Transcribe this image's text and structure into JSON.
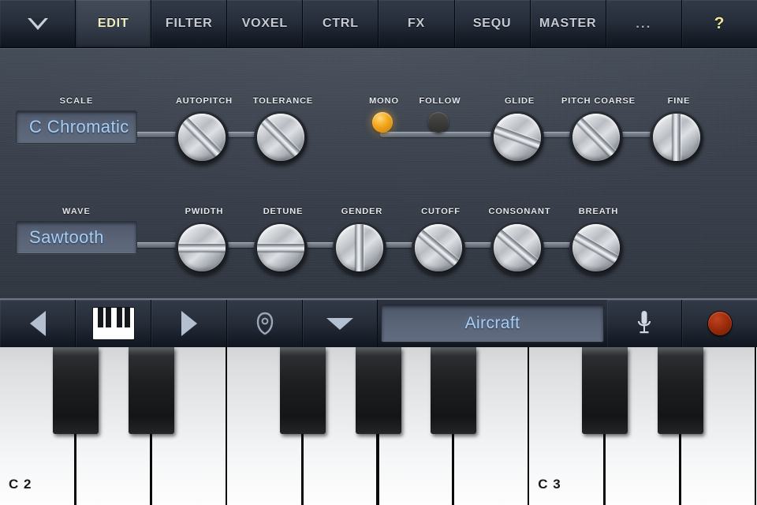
{
  "tabs": [
    {
      "id": "menu",
      "label": "",
      "icon": "triangle-down-icon",
      "active": false
    },
    {
      "id": "edit",
      "label": "EDIT",
      "icon": "",
      "active": true
    },
    {
      "id": "filter",
      "label": "FILTER",
      "icon": "",
      "active": false
    },
    {
      "id": "voxel",
      "label": "VOXEL",
      "icon": "",
      "active": false
    },
    {
      "id": "ctrl",
      "label": "CTRL",
      "icon": "",
      "active": false
    },
    {
      "id": "fx",
      "label": "FX",
      "icon": "",
      "active": false
    },
    {
      "id": "sequ",
      "label": "SEQU",
      "icon": "",
      "active": false
    },
    {
      "id": "master",
      "label": "MASTER",
      "icon": "",
      "active": false
    },
    {
      "id": "more",
      "label": "...",
      "icon": "",
      "active": false
    },
    {
      "id": "help",
      "label": "?",
      "icon": "question-mark-icon",
      "active": false
    }
  ],
  "panel": {
    "row1": {
      "display": {
        "label": "SCALE",
        "value": "C Chromatic"
      },
      "knobs": [
        {
          "label": "AUTOPITCH",
          "angle": 45
        },
        {
          "label": "TOLERANCE",
          "angle": 45
        },
        {
          "label": "GLIDE",
          "angle": 20
        },
        {
          "label": "PITCH COARSE",
          "angle": 45
        },
        {
          "label": "FINE",
          "angle": 90
        }
      ],
      "toggles": [
        {
          "label": "MONO",
          "on": true
        },
        {
          "label": "FOLLOW",
          "on": false
        }
      ]
    },
    "row2": {
      "display": {
        "label": "WAVE",
        "value": "Sawtooth"
      },
      "knobs": [
        {
          "label": "PWIDTH",
          "angle": 0
        },
        {
          "label": "DETUNE",
          "angle": 0
        },
        {
          "label": "GENDER",
          "angle": 90
        },
        {
          "label": "CUTOFF",
          "angle": 40
        },
        {
          "label": "CONSONANT",
          "angle": 40
        },
        {
          "label": "BREATH",
          "angle": 30
        }
      ]
    }
  },
  "bottombar": {
    "prev_label": "",
    "keyboard_label": "",
    "next_label": "",
    "preset_icon_label": "",
    "dropdown_label": "",
    "preset_name": "Aircraft",
    "mic_label": "",
    "record_label": ""
  },
  "keyboard": {
    "octave_labels": [
      {
        "key_index": 0,
        "label": "C 2"
      },
      {
        "key_index": 7,
        "label": "C 3"
      }
    ]
  },
  "colors": {
    "accent_blue": "#a9cdf3",
    "led_on": "#f4a81d",
    "record_red": "#9e2c0d",
    "active_tab_text": "#f0efc4",
    "panel_bg": "#3b424e"
  }
}
